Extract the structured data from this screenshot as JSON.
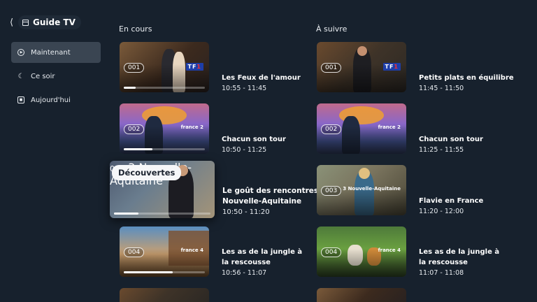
{
  "sidebar": {
    "back_icon": "chevron-left-icon",
    "title": "Guide TV",
    "title_icon": "tv-guide-icon",
    "items": [
      {
        "label": "Maintenant",
        "icon": "play-circle-icon",
        "active": true
      },
      {
        "label": "Ce soir",
        "icon": "moon-icon",
        "active": false
      },
      {
        "label": "Aujourd'hui",
        "icon": "calendar-icon",
        "active": false
      }
    ]
  },
  "columns": {
    "now_title": "En cours",
    "next_title": "À suivre"
  },
  "now": [
    {
      "channel": "001",
      "network": "TF1",
      "title_lines": [
        "Les Feux de l'amour"
      ],
      "time": "10:55 - 11:45",
      "progress": 0.15
    },
    {
      "channel": "002",
      "network": "france 2",
      "title_lines": [
        "Chacun son tour"
      ],
      "time": "10:50 - 11:25",
      "progress": 0.35
    },
    {
      "channel": "003",
      "network": "3 Nouvelle-Aquitaine",
      "badge": "Découvertes",
      "title_lines": [
        "Le goût des rencontres",
        "Nouvelle-Aquitaine"
      ],
      "time": "10:50 - 11:20",
      "progress": 0.25,
      "focused": true
    },
    {
      "channel": "004",
      "network": "france 4",
      "title_lines": [
        "Les as de la jungle à",
        "la rescousse"
      ],
      "time": "10:56 - 11:07",
      "progress": 0.6
    }
  ],
  "next": [
    {
      "channel": "001",
      "network": "TF1",
      "title_lines": [
        "Petits plats en équilibre"
      ],
      "time": "11:45 - 11:50"
    },
    {
      "channel": "002",
      "network": "france 2",
      "title_lines": [
        "Chacun son tour"
      ],
      "time": "11:25 - 11:55"
    },
    {
      "channel": "003",
      "network": "3 Nouvelle-Aquitaine",
      "title_lines": [
        "Flavie en France"
      ],
      "time": "11:20 - 12:00"
    },
    {
      "channel": "004",
      "network": "france 4",
      "title_lines": [
        "Les as de la jungle à",
        "la rescousse"
      ],
      "time": "11:07 - 11:08"
    }
  ],
  "colors": {
    "background": "#17212d",
    "active_nav": "#3a4552",
    "badge_bg": "#f6f7f9"
  }
}
